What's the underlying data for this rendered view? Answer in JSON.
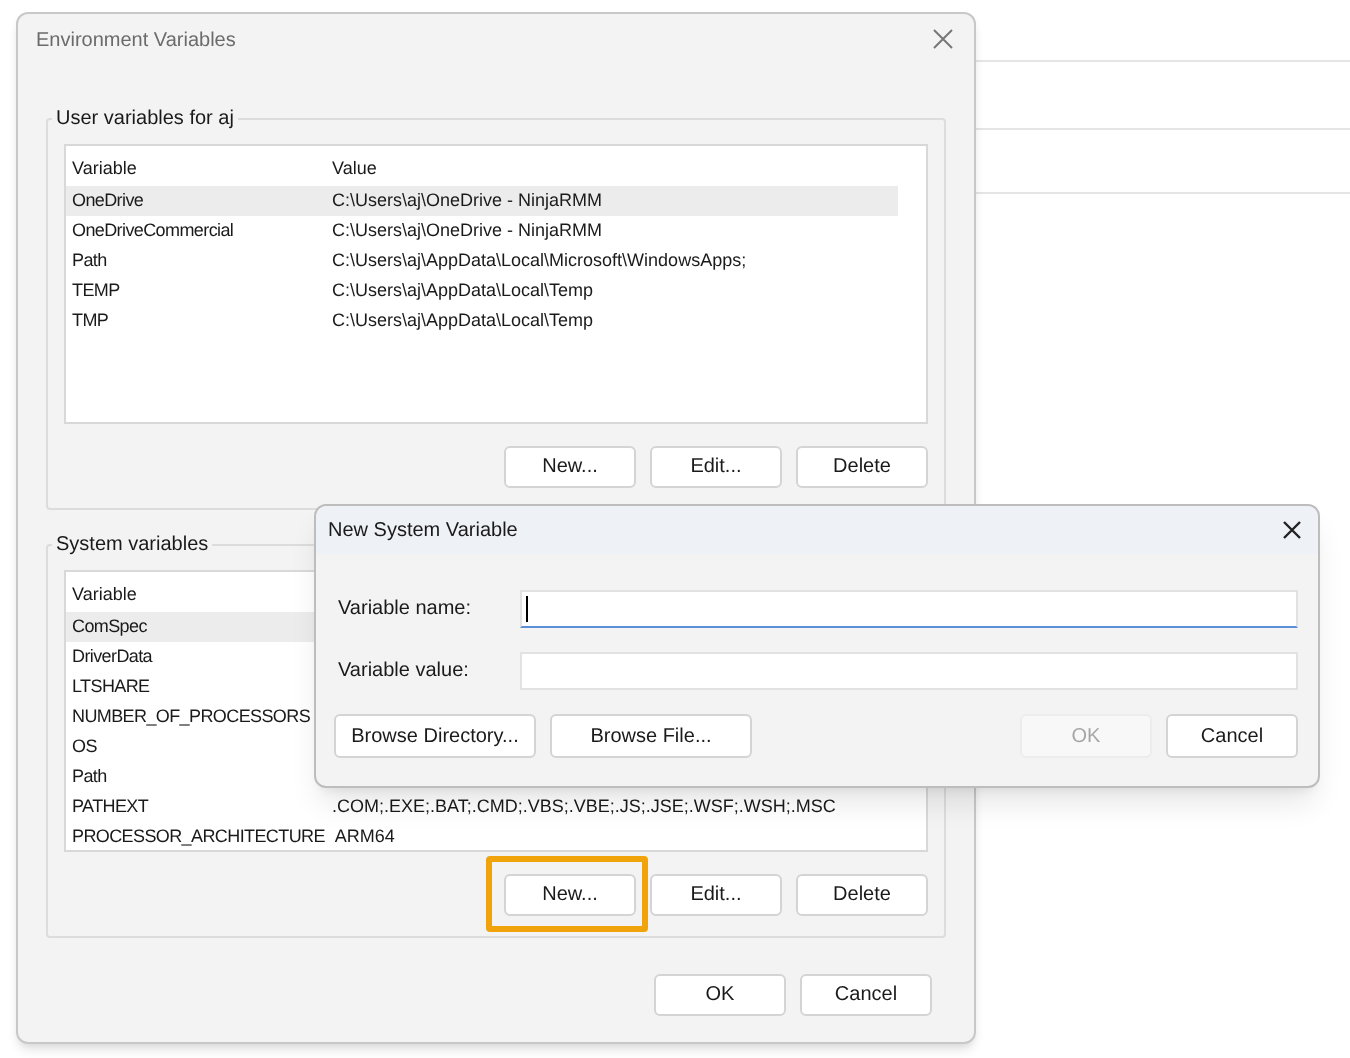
{
  "window": {
    "title": "Environment Variables"
  },
  "user_variables": {
    "label": "User variables for aj",
    "columns": [
      "Variable",
      "Value"
    ],
    "rows": [
      {
        "variable": "OneDrive",
        "value": "C:\\Users\\aj\\OneDrive - NinjaRMM",
        "selected": true
      },
      {
        "variable": "OneDriveCommercial",
        "value": "C:\\Users\\aj\\OneDrive - NinjaRMM",
        "selected": false
      },
      {
        "variable": "Path",
        "value": "C:\\Users\\aj\\AppData\\Local\\Microsoft\\WindowsApps;",
        "selected": false
      },
      {
        "variable": "TEMP",
        "value": "C:\\Users\\aj\\AppData\\Local\\Temp",
        "selected": false
      },
      {
        "variable": "TMP",
        "value": "C:\\Users\\aj\\AppData\\Local\\Temp",
        "selected": false
      }
    ],
    "buttons": [
      {
        "label": "New..."
      },
      {
        "label": "Edit..."
      },
      {
        "label": "Delete"
      }
    ]
  },
  "system_variables": {
    "label": "System variables",
    "columns": [
      "Variable"
    ],
    "rows": [
      {
        "variable": "ComSpec",
        "selected": true
      },
      {
        "variable": "DriverData",
        "selected": false
      },
      {
        "variable": "LTSHARE",
        "selected": false
      },
      {
        "variable": "NUMBER_OF_PROCESSORS",
        "selected": false
      },
      {
        "variable": "OS",
        "selected": false
      },
      {
        "variable": "Path",
        "selected": false
      },
      {
        "variable": "PATHEXT",
        "value": ".COM;.EXE;.BAT;.CMD;.VBS;.VBE;.JS;.JSE;.WSF;.WSH;.MSC",
        "selected": false
      },
      {
        "variable": "PROCESSOR_ARCHITECTURE",
        "value": "ARM64",
        "selected": false
      }
    ],
    "buttons": [
      {
        "label": "New...",
        "highlighted": true
      },
      {
        "label": "Edit..."
      },
      {
        "label": "Delete"
      }
    ]
  },
  "footer_buttons": [
    {
      "label": "OK"
    },
    {
      "label": "Cancel"
    }
  ],
  "new_variable_dialog": {
    "title": "New System Variable",
    "fields": [
      {
        "label": "Variable name:",
        "focused": true
      },
      {
        "label": "Variable value:",
        "focused": false
      }
    ],
    "buttons": [
      {
        "label": "Browse Directory...",
        "disabled": false
      },
      {
        "label": "Browse File...",
        "disabled": false
      },
      {
        "label": "OK",
        "disabled": true
      },
      {
        "label": "Cancel",
        "disabled": false
      }
    ]
  }
}
